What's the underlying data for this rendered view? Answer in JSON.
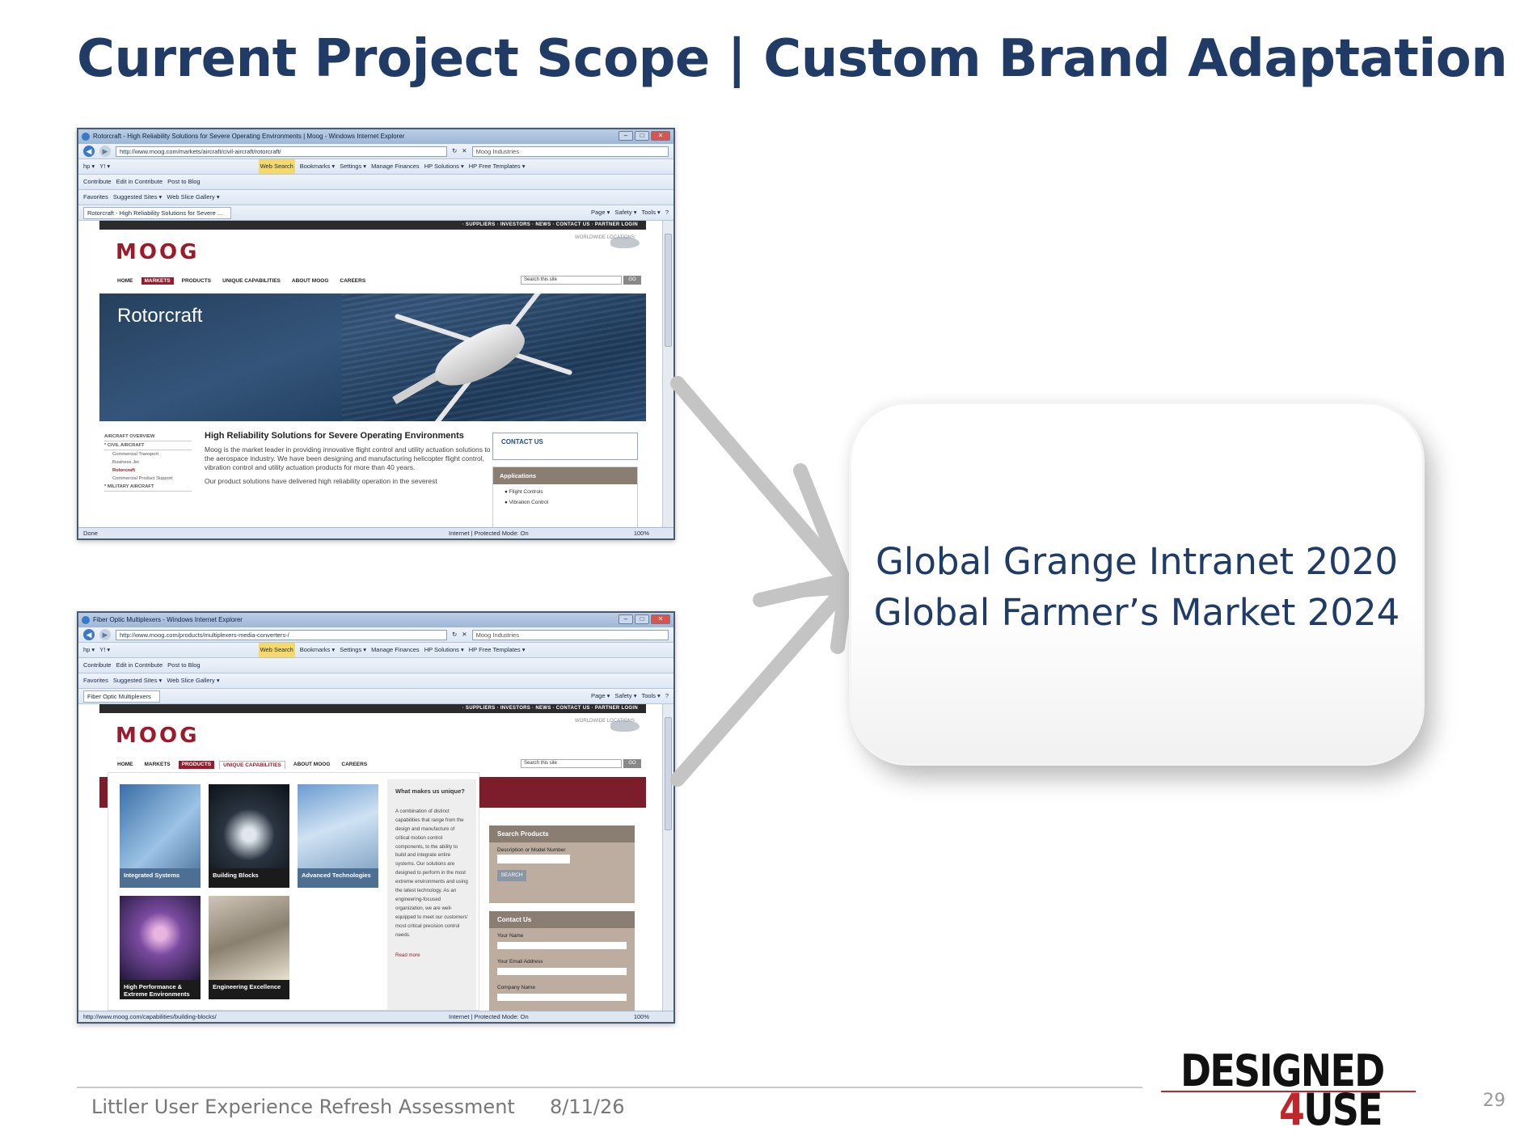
{
  "slide": {
    "title": "Current Project Scope | Custom Brand Adaptation",
    "page_number": "29"
  },
  "screenshots": [
    {
      "window_title": "Rotorcraft - High Reliability Solutions for Severe Operating Environments | Moog - Windows Internet Explorer",
      "address": "http://www.moog.com/markets/aircraft/civil-aircraft/rotorcraft/",
      "search_placeholder": "Moog Industries",
      "tab_label": "Rotorcraft - High Reliability Solutions for Severe ...",
      "status_left": "Done",
      "hero_title": "Rotorcraft",
      "content_heading": "High Reliability Solutions for Severe Operating Environments",
      "content_paragraph_1": "Moog is the market leader in providing innovative flight control and utility actuation solutions to the aerospace industry.  We have been designing and manufacturing helicopter flight control, vibration control and utility actuation products for more than 40 years.",
      "content_paragraph_2": "Our product solutions have delivered high reliability operation in the severest",
      "sidebar": {
        "overview": "AIRCRAFT OVERVIEW",
        "civil": "* CIVIL AIRCRAFT",
        "items": [
          "Commercial Transport",
          "Business Jet",
          "Rotorcraft",
          "Commercial Product Support"
        ],
        "military": "* MILITARY AIRCRAFT"
      },
      "contact_label": "CONTACT US",
      "applications_label": "Applications",
      "applications_items": [
        "Flight Controls",
        "Vibration Control"
      ]
    },
    {
      "window_title": "Fiber Optic Multiplexers - Windows Internet Explorer",
      "address": "http://www.moog.com/products/multiplexers-media-converters-/",
      "search_placeholder": "Moog Industries",
      "tab_label": "Fiber Optic Multiplexers",
      "status_left": "http://www.moog.com/capabilities/building-blocks/",
      "tiles": [
        "Integrated Systems",
        "Building Blocks",
        "Advanced Technologies",
        "High Performance & Extreme Environments",
        "Engineering Excellence"
      ],
      "unique_heading": "What makes us unique?",
      "unique_text": "A combination of distinct capabilities that range from the design and manufacture of critical motion control components, to the ability to build and integrate entire systems. Our solutions are designed to perform in the most extreme environments and using the latest technology. As an engineering-focused organization, we are well-equipped to meet our customers' most critical precision control needs.",
      "read_more": "Read more",
      "search_products_label": "Search Products",
      "model_number_label": "Description or Model Number",
      "search_button": "SEARCH",
      "contact_label": "Contact Us",
      "your_name": "Your Name",
      "your_email": "Your Email Address",
      "company_name": "Company Name"
    }
  ],
  "browser_common": {
    "toolbar_items": [
      "Web Search",
      "Bookmarks ▾",
      "Settings ▾",
      "Manage Finances",
      "HP Solutions ▾",
      "HP Free Templates ▾"
    ],
    "contribute_items": [
      "Contribute",
      "Edit in Contribute",
      "Post to Blog"
    ],
    "favorites_items": [
      "Favorites",
      "Suggested Sites ▾",
      "Web Slice Gallery ▾"
    ],
    "command_items": [
      "Page ▾",
      "Safety ▾",
      "Tools ▾"
    ],
    "status_zone": "Internet | Protected Mode: On",
    "status_zoom": "100%",
    "moog_logo": "MOOG",
    "moog_topbar": "· SUPPLIERS   · INVESTORS   · NEWS   · CONTACT US   · PARTNER LOGIN",
    "worldwide": "WORLDWIDE LOCATIONS",
    "nav": [
      "HOME",
      "MARKETS",
      "PRODUCTS",
      "UNIQUE CAPABILITIES",
      "ABOUT MOOG",
      "CAREERS"
    ],
    "site_search": "Search this site",
    "go": "GO"
  },
  "callout": {
    "line1": "Global Grange Intranet 2020",
    "line2": "Global Farmer’s Market 2024"
  },
  "footer": {
    "left_text": "Littler User Experience Refresh Assessment",
    "date": "8/11/26"
  },
  "logo": {
    "line1": "DESIGNED",
    "line2_num": "4",
    "line2_text": "USE"
  },
  "colors": {
    "title": "#1f3b66",
    "moog_red": "#9c1b2b",
    "arrow": "#c4c4c4",
    "logo_red": "#c0272d"
  }
}
